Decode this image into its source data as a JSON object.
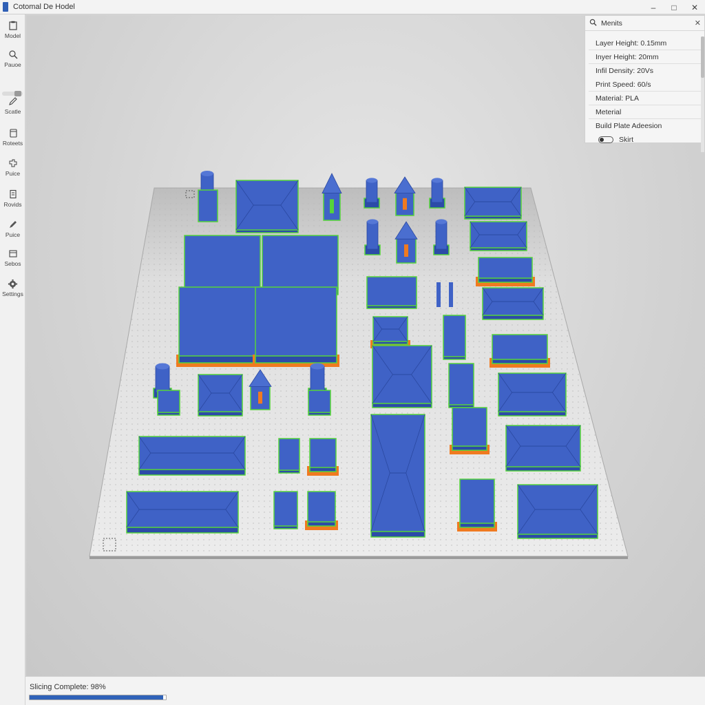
{
  "window": {
    "title": "Cotomal De Hodel",
    "minimize_icon": "minimize-icon",
    "maximize_icon": "maximize-icon",
    "close_icon": "close-icon"
  },
  "toolbar": {
    "items": [
      {
        "label": "Model",
        "icon": "clipboard-icon"
      },
      {
        "label": "Pauoe",
        "icon": "search-plus-icon"
      },
      {
        "label": "Scatle",
        "icon": "pencil-icon"
      },
      {
        "label": "Roteets",
        "icon": "cube-icon"
      },
      {
        "label": "Puice",
        "icon": "tools-icon"
      },
      {
        "label": "Rovids",
        "icon": "document-icon"
      },
      {
        "label": "Puice",
        "icon": "pen-icon"
      },
      {
        "label": "Sebos",
        "icon": "box-icon"
      },
      {
        "label": "Settings",
        "icon": "gear-icon"
      }
    ]
  },
  "settings_panel": {
    "search_label": "Menits",
    "rows": [
      "Layer Height: 0.15mm",
      "Inyer Height: 20mm",
      "Infil Density: 20Vs",
      "Print Speed: 60/s",
      "Material: PLA",
      "Meterial",
      "Build Plate Adeesion"
    ],
    "skirt_label": "Skirt"
  },
  "status": {
    "text": "Slicing Complete: 98%",
    "progress": 0.98
  },
  "colors": {
    "model_blue": "#3f62c6",
    "model_blue_dark": "#2c4ba8",
    "outline_green": "#56d43a",
    "brim_orange": "#f07a20",
    "plate": "#ebebeb",
    "accent": "#2f62b8"
  }
}
